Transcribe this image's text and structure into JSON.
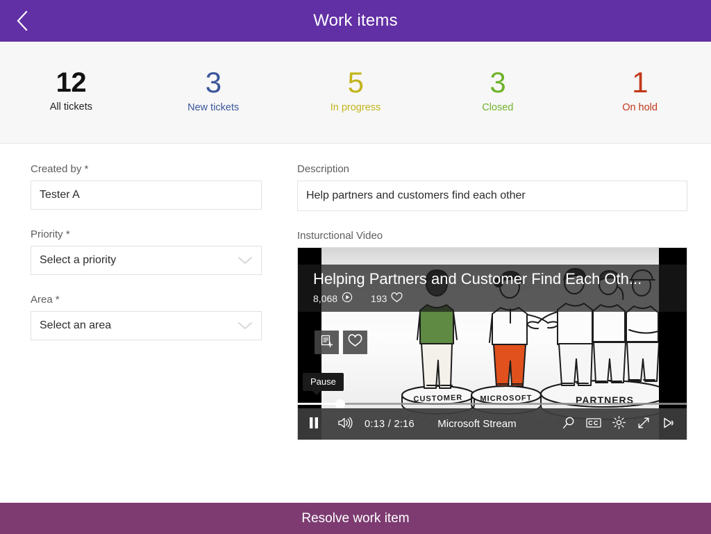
{
  "header": {
    "title": "Work items",
    "back_icon": "chevron-left-icon",
    "bg_color": "#6230a5"
  },
  "stats": [
    {
      "value": "12",
      "label": "All tickets",
      "color": "#121212"
    },
    {
      "value": "3",
      "label": "New tickets",
      "color": "#3b569a"
    },
    {
      "value": "5",
      "label": "In progress",
      "color": "#c2b41c"
    },
    {
      "value": "3",
      "label": "Closed",
      "color": "#6fb32b"
    },
    {
      "value": "1",
      "label": "On hold",
      "color": "#c2371a"
    }
  ],
  "form": {
    "created_by": {
      "label": "Created by *",
      "value": "Tester A",
      "placeholder": "Created by"
    },
    "priority": {
      "label": "Priority *",
      "value": "Select a priority",
      "chevron": "chevron-down-icon"
    },
    "area": {
      "label": "Area *",
      "value": "Select an area",
      "chevron": "chevron-down-icon"
    },
    "description": {
      "label": "Description",
      "value": "Help partners and customers find each other",
      "placeholder": "Description"
    },
    "video_section_label": "Insturctional Video"
  },
  "video": {
    "title": "Helping Partners and Customer Find Each Oth...",
    "views": "8,068",
    "views_icon": "play-circle-icon",
    "likes": "193",
    "likes_icon": "heart-icon",
    "overlay_buttons": [
      {
        "name": "add-to-watchlist-icon"
      },
      {
        "name": "like-heart-icon"
      }
    ],
    "tooltip": "Pause",
    "current_time": "0:13",
    "time_separator": "/",
    "duration": "2:16",
    "brand": "Microsoft Stream",
    "controls": [
      {
        "name": "pause-icon"
      },
      {
        "name": "volume-icon"
      },
      {
        "name": "search-icon"
      },
      {
        "name": "closed-captions-icon"
      },
      {
        "name": "settings-gear-icon"
      },
      {
        "name": "fullscreen-icon"
      },
      {
        "name": "cast-icon"
      }
    ],
    "illustration": {
      "podium_labels": [
        "CUSTOMER",
        "MICROSOFT",
        "PARTNERS"
      ]
    }
  },
  "footer": {
    "resolve_label": "Resolve work item",
    "bg_color": "#7d3b71"
  }
}
